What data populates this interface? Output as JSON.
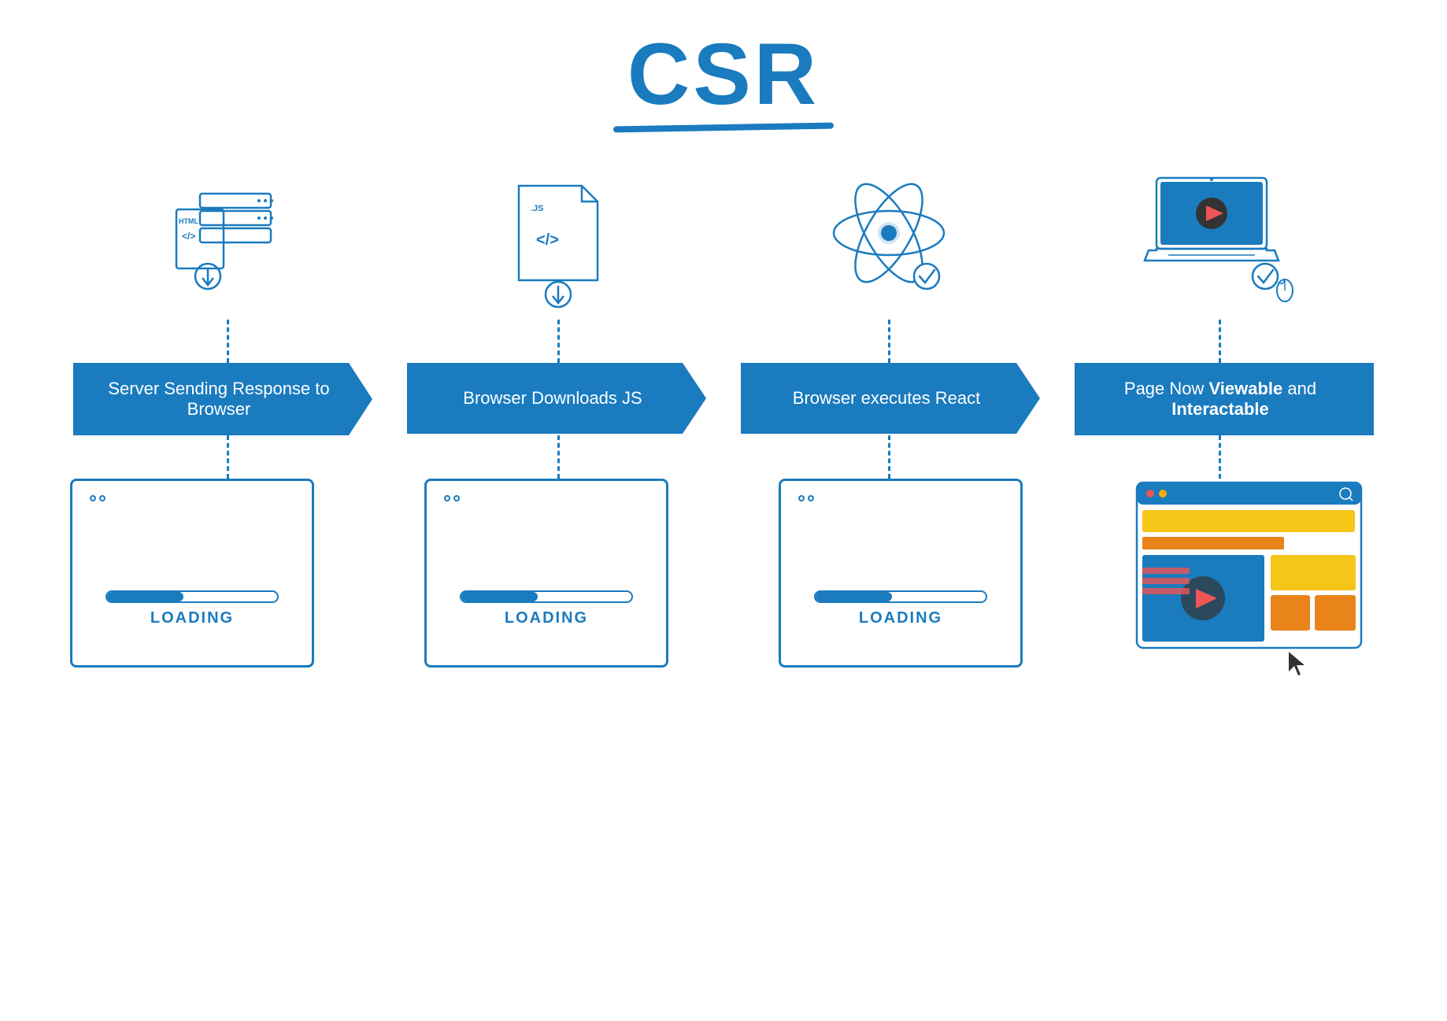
{
  "title": "CSR",
  "accent": "#1a7bbf",
  "steps": [
    {
      "id": "step1",
      "label": "Server Sending Response to Browser",
      "bold_words": [],
      "icon": "html-server",
      "loading": true,
      "loading_text": "LOADING"
    },
    {
      "id": "step2",
      "label": "Browser Downloads JS",
      "bold_words": [],
      "icon": "js-file",
      "loading": true,
      "loading_text": "LOADING"
    },
    {
      "id": "step3",
      "label": "Browser executes React",
      "bold_words": [],
      "icon": "react-atom",
      "loading": true,
      "loading_text": "LOADING"
    },
    {
      "id": "step4",
      "label": "Page Now Viewable and Interactable",
      "bold_words": [
        "Viewable",
        "Interactable"
      ],
      "icon": "laptop-play",
      "loading": false,
      "loading_text": ""
    }
  ]
}
